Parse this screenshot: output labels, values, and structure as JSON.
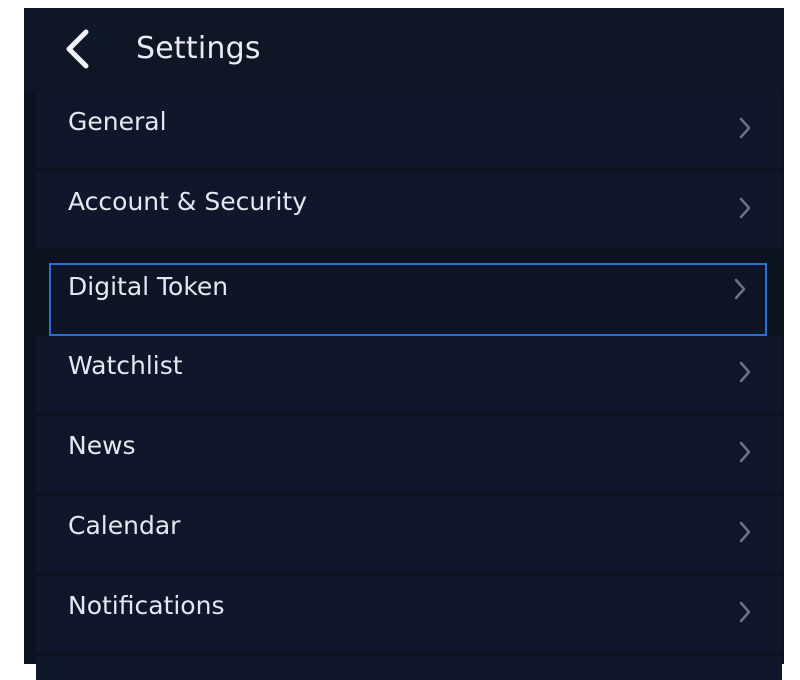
{
  "header": {
    "title": "Settings",
    "back_icon": "chevron-left-icon"
  },
  "menu": {
    "items": [
      {
        "label": "General",
        "icon": "chevron-right-icon",
        "selected": false
      },
      {
        "label": "Account & Security",
        "icon": "chevron-right-icon",
        "selected": false
      },
      {
        "label": "Digital Token",
        "icon": "chevron-right-icon",
        "selected": true
      },
      {
        "label": "Watchlist",
        "icon": "chevron-right-icon",
        "selected": false
      },
      {
        "label": "News",
        "icon": "chevron-right-icon",
        "selected": false
      },
      {
        "label": "Calendar",
        "icon": "chevron-right-icon",
        "selected": false
      },
      {
        "label": "Notifications",
        "icon": "chevron-right-icon",
        "selected": false
      }
    ]
  },
  "colors": {
    "background": "#0c1220",
    "row": "#10172a",
    "text": "#e4e8ef",
    "chevron": "#6b7385",
    "focus": "#2b6fd8"
  }
}
